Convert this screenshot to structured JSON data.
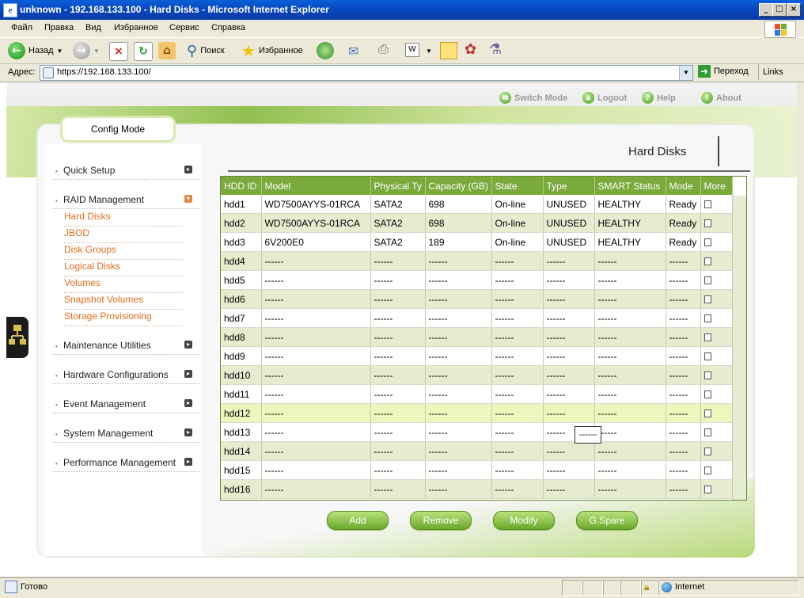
{
  "window": {
    "title": "unknown - 192.168.133.100 - Hard Disks - Microsoft Internet Explorer"
  },
  "menu": [
    "Файл",
    "Правка",
    "Вид",
    "Избранное",
    "Сервис",
    "Справка"
  ],
  "toolbar": {
    "back": "Назад",
    "search": "Поиск",
    "favorites": "Избранное"
  },
  "address": {
    "label": "Адрес:",
    "url": "https://192.168.133.100/",
    "go": "Переход",
    "links": "Links"
  },
  "status": {
    "text": "Готово",
    "zone": "Internet"
  },
  "topnav": {
    "switch_mode": "Switch Mode",
    "logout": "Logout",
    "help": "Help",
    "about": "About"
  },
  "config_tab": "Config Mode",
  "page_title": "Hard Disks",
  "sidebar": {
    "items": [
      {
        "label": "Quick Setup"
      },
      {
        "label": "RAID Management"
      },
      {
        "label": "Maintenance Utilities"
      },
      {
        "label": "Hardware Configurations"
      },
      {
        "label": "Event Management"
      },
      {
        "label": "System Management"
      },
      {
        "label": "Performance Management"
      }
    ],
    "raid_sub": [
      "Hard Disks",
      "JBOD",
      "Disk Groups",
      "Logical Disks",
      "Volumes",
      "Snapshot Volumes",
      "Storage Provisioning"
    ]
  },
  "table": {
    "headers": [
      "HDD ID",
      "Model",
      "Physical Ty",
      "Capacity (GB)",
      "State",
      "Type",
      "SMART Status",
      "Mode",
      "More"
    ],
    "rows": [
      [
        "hdd1",
        "WD7500AYYS-01RCA",
        "SATA2",
        "698",
        "On-line",
        "UNUSED",
        "HEALTHY",
        "Ready"
      ],
      [
        "hdd2",
        "WD7500AYYS-01RCA",
        "SATA2",
        "698",
        "On-line",
        "UNUSED",
        "HEALTHY",
        "Ready"
      ],
      [
        "hdd3",
        "6V200E0",
        "SATA2",
        "189",
        "On-line",
        "UNUSED",
        "HEALTHY",
        "Ready"
      ],
      [
        "hdd4",
        "------",
        "------",
        "------",
        "------",
        "------",
        "------",
        "------"
      ],
      [
        "hdd5",
        "------",
        "------",
        "------",
        "------",
        "------",
        "------",
        "------"
      ],
      [
        "hdd6",
        "------",
        "------",
        "------",
        "------",
        "------",
        "------",
        "------"
      ],
      [
        "hdd7",
        "------",
        "------",
        "------",
        "------",
        "------",
        "------",
        "------"
      ],
      [
        "hdd8",
        "------",
        "------",
        "------",
        "------",
        "------",
        "------",
        "------"
      ],
      [
        "hdd9",
        "------",
        "------",
        "------",
        "------",
        "------",
        "------",
        "------"
      ],
      [
        "hdd10",
        "------",
        "------",
        "------",
        "------",
        "------",
        "------",
        "------"
      ],
      [
        "hdd11",
        "------",
        "------",
        "------",
        "------",
        "------",
        "------",
        "------"
      ],
      [
        "hdd12",
        "------",
        "------",
        "------",
        "------",
        "------",
        "------",
        "------"
      ],
      [
        "hdd13",
        "------",
        "------",
        "------",
        "------",
        "------",
        "------",
        "------"
      ],
      [
        "hdd14",
        "------",
        "------",
        "------",
        "------",
        "------",
        "------",
        "------"
      ],
      [
        "hdd15",
        "------",
        "------",
        "------",
        "------",
        "------",
        "------",
        "------"
      ],
      [
        "hdd16",
        "------",
        "------",
        "------",
        "------",
        "------",
        "------",
        "------"
      ]
    ]
  },
  "tooltip": "------",
  "buttons": {
    "add": "Add",
    "remove": "Remove",
    "modify": "Modify",
    "gspare": "G.Spare"
  },
  "colors": {
    "accent_green": "#7aaa3c",
    "link_orange": "#e26c1c",
    "title_blue": "#0642b8"
  }
}
